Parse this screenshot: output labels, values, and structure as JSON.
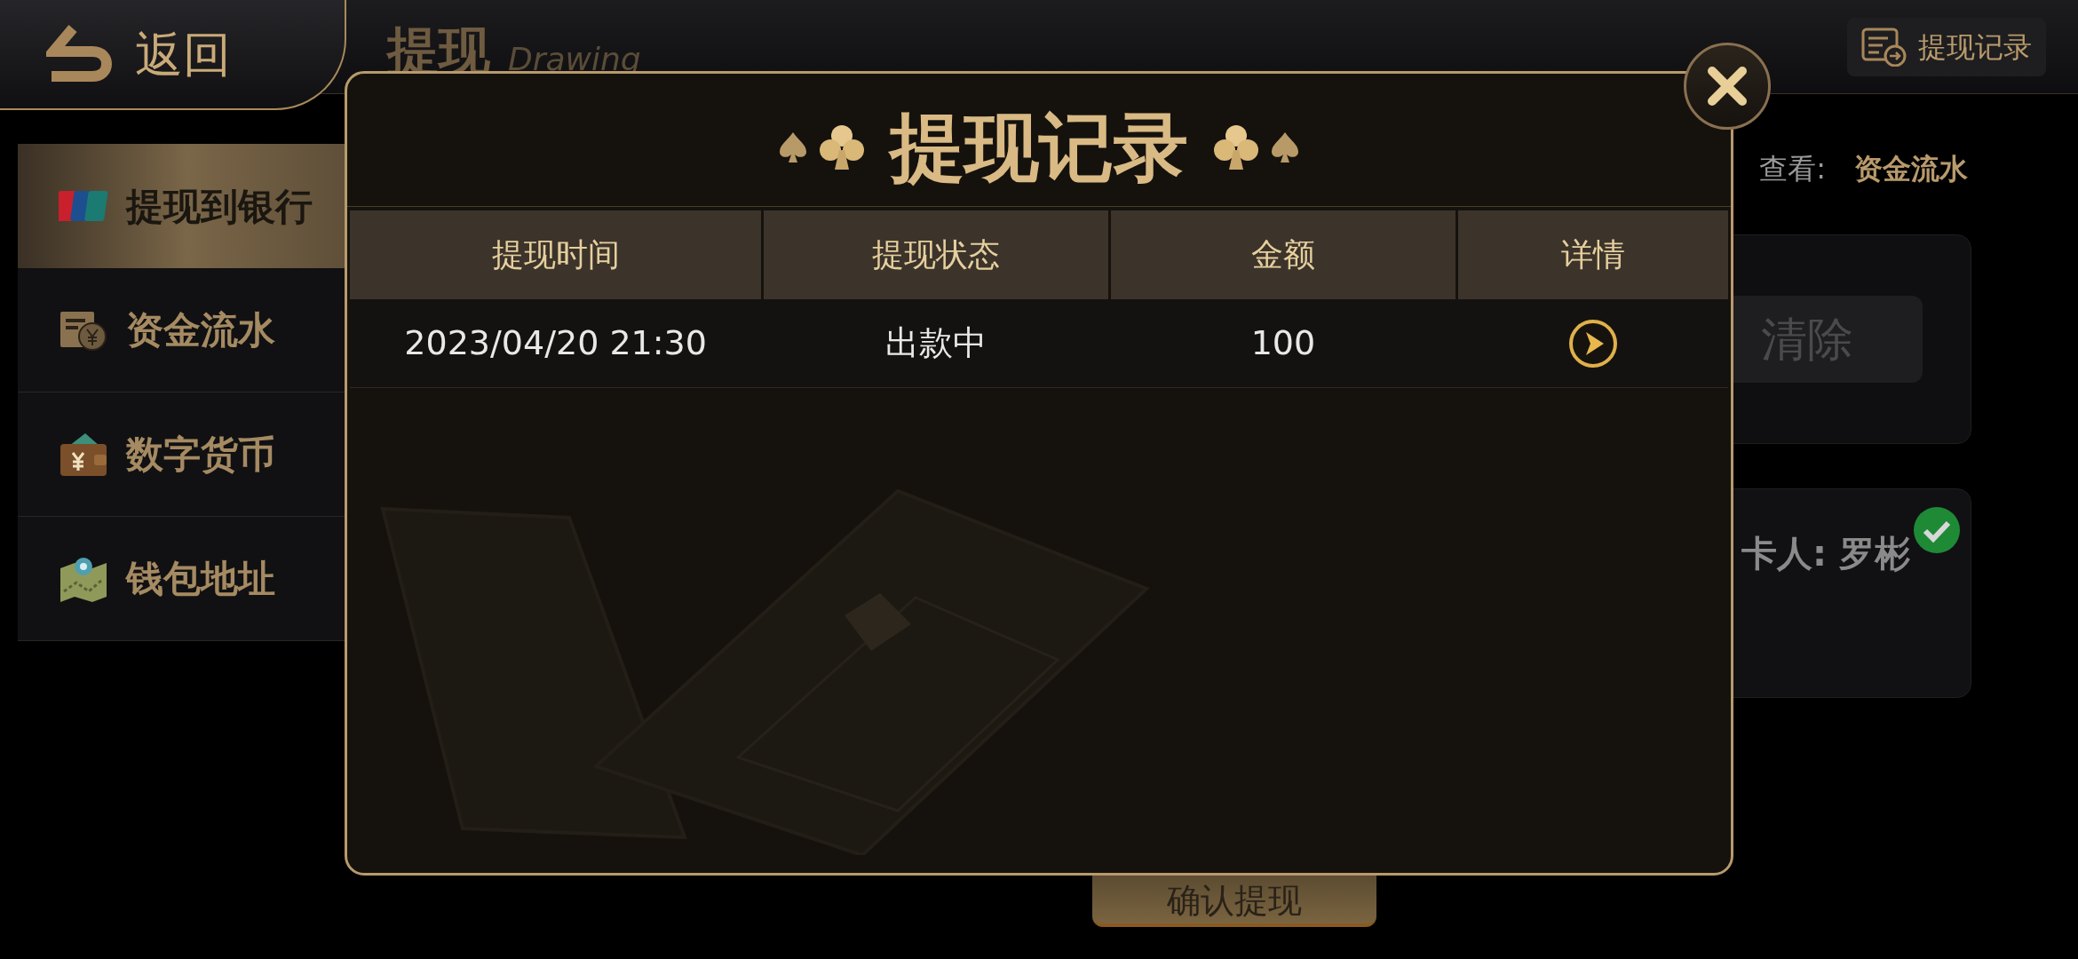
{
  "header": {
    "back_label": "返回",
    "title": "提现",
    "subtitle": "Drawing",
    "records_button": "提现记录"
  },
  "sidebar": {
    "items": [
      {
        "label": "提现到银行",
        "selected": true,
        "kind": "bank"
      },
      {
        "label": "资金流水",
        "selected": false,
        "kind": "funds"
      },
      {
        "label": "数字货币",
        "selected": false,
        "kind": "wallet"
      },
      {
        "label": "钱包地址",
        "selected": false,
        "kind": "map"
      }
    ]
  },
  "content": {
    "hint_label": "查看:",
    "hint_link": "资金流水",
    "clear_button": "清除",
    "cardholder": "卡人: 罗彬",
    "verified": true,
    "confirm_button": "确认提现"
  },
  "dialog": {
    "title": "提现记录",
    "columns": [
      "提现时间",
      "提现状态",
      "金额",
      "详情"
    ],
    "rows": [
      {
        "time": "2023/04/20 21:30",
        "status": "出款中",
        "amount": "100"
      }
    ]
  }
}
